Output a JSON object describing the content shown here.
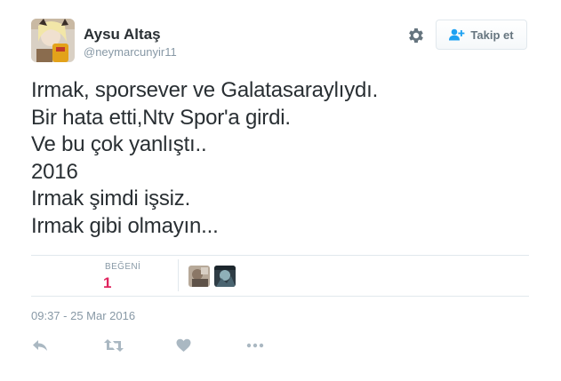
{
  "author": {
    "name": "Aysu Altaş",
    "handle": "@neymarcunyir11"
  },
  "header": {
    "settings_icon": "gear-icon",
    "follow_icon": "follow-person-plus-icon",
    "follow_label": "Takip et"
  },
  "tweet": {
    "lines": [
      "Irmak, sporsever ve Galatasaraylıydı.",
      "Bir hata etti,Ntv Spor'a girdi.",
      "Ve bu çok yanlıştı..",
      "2016",
      "Irmak şimdi işsiz.",
      "Irmak gibi olmayın..."
    ]
  },
  "stats": {
    "likes_label": "BEĞENİ",
    "likes_count": "1"
  },
  "timestamp": "09:37 - 25 Mar 2016",
  "actions": [
    "reply-icon",
    "retweet-icon",
    "like-heart-icon",
    "more-icon"
  ],
  "colors": {
    "text": "#292f33",
    "muted": "#8899a6",
    "like": "#e0245e",
    "follow_icon": "#1da1f2",
    "border": "#e1e8ed"
  }
}
